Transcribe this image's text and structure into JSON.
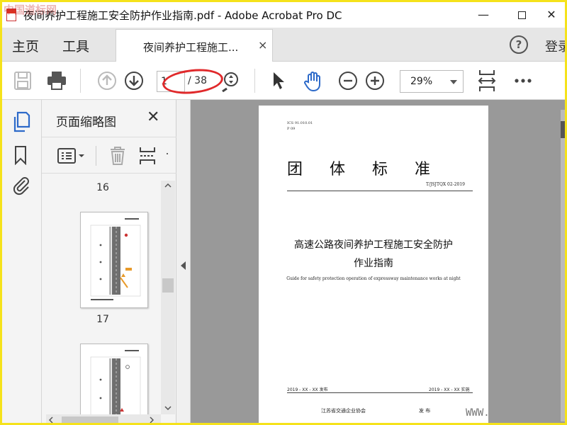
{
  "window": {
    "title": "夜间养护工程施工安全防护作业指南.pdf - Adobe Acrobat Pro DC",
    "min": "—",
    "close": "✕"
  },
  "nav": {
    "home": "主页",
    "tools": "工具",
    "tab_label": "夜间养护工程施工...",
    "tab_close": "×",
    "help": "?",
    "signin": "登录"
  },
  "toolbar": {
    "page_current": "1",
    "page_total": "/ 38",
    "zoom": "29%"
  },
  "panel": {
    "title": "页面缩略图",
    "close": "✕",
    "pages": [
      "16",
      "17"
    ]
  },
  "document": {
    "ics": "ICS 91.010.01",
    "p": "P 09",
    "heading": "团体标准",
    "standard_no": "T/JSJTQX 02-2019",
    "title_line1": "高速公路夜间养护工程施工安全防护",
    "title_line2": "作业指南",
    "title_en": "Guide for safety protection operation of expressway maintenance works at night",
    "issue_date": "2019 - XX - XX 发布",
    "impl_date": "2019 - XX - XX 实施",
    "publisher": "江苏省交通企业协会",
    "publish": "发  布"
  },
  "watermarks": {
    "top": "中国道标网",
    "bottom": "WWW."
  },
  "colors": {
    "accent": "#2d6ac9",
    "highlight": "#e0292b",
    "frame": "#f5e21b"
  }
}
